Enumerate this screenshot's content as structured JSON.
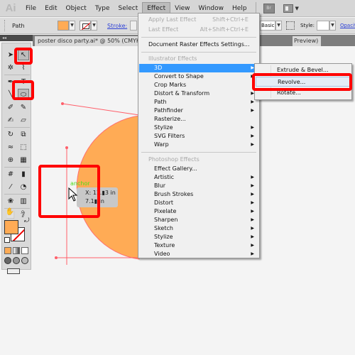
{
  "app": {
    "logo": "Ai"
  },
  "menubar": {
    "items": [
      "File",
      "Edit",
      "Object",
      "Type",
      "Select",
      "Effect",
      "View",
      "Window",
      "Help"
    ],
    "active": "Effect",
    "bridge_label": "Br"
  },
  "controlbar": {
    "selection_label": "Path",
    "fill_color": "#ffab55",
    "stroke_label": "Stroke:",
    "brush_value": "Basic",
    "style_label": "Style:",
    "opacity_label": "Opacity:"
  },
  "document": {
    "tab_title": "poster disco party.ai* @ 50% (CMYK",
    "tab_title_end": "Preview)",
    "close_glyph": "×"
  },
  "tools": {
    "panel_collapse_glyph": "◂◂",
    "items": [
      {
        "name": "selection-tool",
        "glyph": "➤"
      },
      {
        "name": "direct-selection-tool",
        "glyph": "↖",
        "selected": true
      },
      {
        "name": "magic-wand-tool",
        "glyph": "✲"
      },
      {
        "name": "lasso-tool",
        "glyph": "⌇"
      },
      {
        "name": "pen-tool",
        "glyph": "✒"
      },
      {
        "name": "type-tool",
        "glyph": "T"
      },
      {
        "name": "line-tool",
        "glyph": "╲"
      },
      {
        "name": "ellipse-tool",
        "glyph": "⬭",
        "selected": true
      },
      {
        "name": "paintbrush-tool",
        "glyph": "🖌"
      },
      {
        "name": "pencil-tool",
        "glyph": "✎"
      },
      {
        "name": "blob-brush-tool",
        "glyph": "✐"
      },
      {
        "name": "eraser-tool",
        "glyph": "▱"
      },
      {
        "name": "rotate-tool",
        "glyph": "↻"
      },
      {
        "name": "scale-tool",
        "glyph": "⧉"
      },
      {
        "name": "warp-tool",
        "glyph": "≈"
      },
      {
        "name": "free-transform-tool",
        "glyph": "⬚"
      },
      {
        "name": "shape-builder-tool",
        "glyph": "⊕"
      },
      {
        "name": "perspective-grid-tool",
        "glyph": "▦"
      },
      {
        "name": "mesh-tool",
        "glyph": "#"
      },
      {
        "name": "gradient-tool",
        "glyph": "▮"
      },
      {
        "name": "eyedropper-tool",
        "glyph": "⁄"
      },
      {
        "name": "blend-tool",
        "glyph": "◔"
      },
      {
        "name": "symbol-sprayer-tool",
        "glyph": "❀"
      },
      {
        "name": "column-graph-tool",
        "glyph": "▥"
      },
      {
        "name": "artboard-tool",
        "glyph": "⬜"
      },
      {
        "name": "slice-tool",
        "glyph": "⫽"
      },
      {
        "name": "hand-tool",
        "glyph": "✋"
      },
      {
        "name": "zoom-tool",
        "glyph": "🔍"
      }
    ],
    "fill_color": "#ffab55",
    "swap_glyph": "⤾"
  },
  "canvas": {
    "shape_fill": "#ffab55",
    "path_color": "#ff5f6a",
    "anchor_label": "anchor",
    "tooltip_x": "X: 11.▮3 in",
    "tooltip_y": "7.1▮ in"
  },
  "effect_menu": {
    "apply_last": {
      "label": "Apply Last Effect",
      "shortcut": "Shift+Ctrl+E"
    },
    "last_effect": {
      "label": "Last Effect",
      "shortcut": "Alt+Shift+Ctrl+E"
    },
    "doc_raster": "Document Raster Effects Settings...",
    "illustrator_header": "Illustrator Effects",
    "illustrator_items": [
      {
        "label": "3D",
        "submenu": true,
        "highlighted": true
      },
      {
        "label": "Convert to Shape",
        "submenu": true
      },
      {
        "label": "Crop Marks",
        "submenu": false
      },
      {
        "label": "Distort & Transform",
        "submenu": true
      },
      {
        "label": "Path",
        "submenu": true
      },
      {
        "label": "Pathfinder",
        "submenu": true
      },
      {
        "label": "Rasterize...",
        "submenu": false
      },
      {
        "label": "Stylize",
        "submenu": true
      },
      {
        "label": "SVG Filters",
        "submenu": true
      },
      {
        "label": "Warp",
        "submenu": true
      }
    ],
    "photoshop_header": "Photoshop Effects",
    "photoshop_items": [
      {
        "label": "Effect Gallery...",
        "submenu": false
      },
      {
        "label": "Artistic",
        "submenu": true
      },
      {
        "label": "Blur",
        "submenu": true
      },
      {
        "label": "Brush Strokes",
        "submenu": true
      },
      {
        "label": "Distort",
        "submenu": true
      },
      {
        "label": "Pixelate",
        "submenu": true
      },
      {
        "label": "Sharpen",
        "submenu": true
      },
      {
        "label": "Sketch",
        "submenu": true
      },
      {
        "label": "Stylize",
        "submenu": true
      },
      {
        "label": "Texture",
        "submenu": true
      },
      {
        "label": "Video",
        "submenu": true
      }
    ],
    "arrow_glyph": "▶"
  },
  "submenu_3d": {
    "items": [
      "Extrude & Bevel...",
      "Revolve...",
      "Rotate..."
    ],
    "hovered": "Revolve..."
  },
  "annotations": {
    "highlight_color": "#ff0000"
  }
}
